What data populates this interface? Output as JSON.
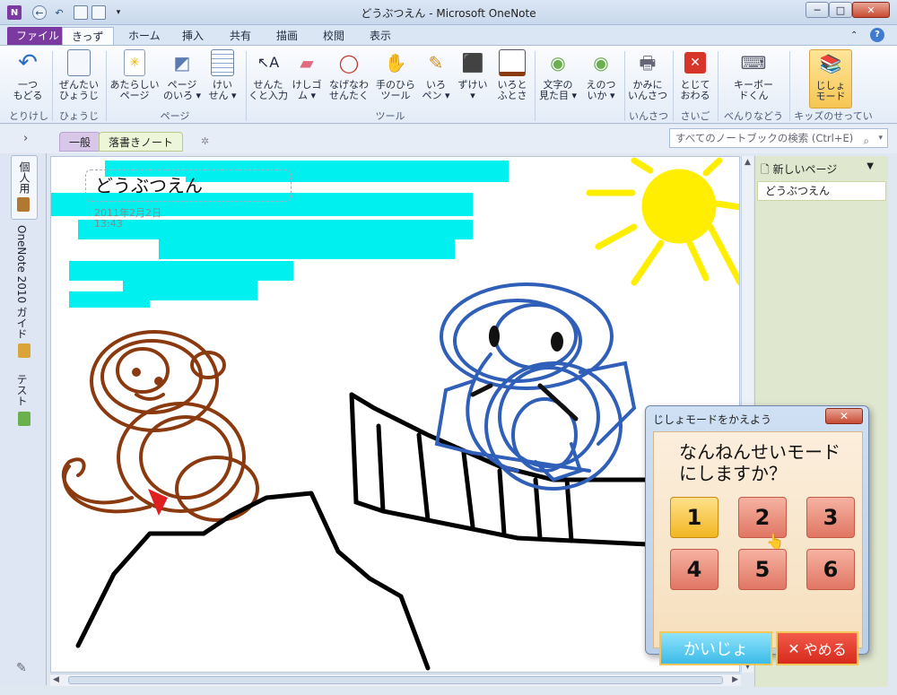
{
  "window": {
    "title": "どうぶつえん - Microsoft OneNote",
    "app_icon": "N",
    "controls": {
      "minimize": "─",
      "maximize": "□",
      "close": "✕"
    }
  },
  "tabs": [
    "ファイル",
    "きっず",
    "ホーム",
    "挿入",
    "共有",
    "描画",
    "校閲",
    "表示"
  ],
  "ribbon": {
    "buttons": [
      {
        "label": "一つ\nもどる",
        "icon": "undo-icon"
      },
      {
        "label": "ぜんたい\nひょうじ",
        "icon": "full-view-icon"
      },
      {
        "label": "あたらしい\nページ",
        "icon": "new-page-icon"
      },
      {
        "label": "ページ\nのいろ ▾",
        "icon": "page-color-icon"
      },
      {
        "label": "けい\nせん ▾",
        "icon": "rule-lines-icon"
      },
      {
        "label": "せんた\nくと入力",
        "icon": "select-text-icon"
      },
      {
        "label": "けしゴ\nム ▾",
        "icon": "eraser-icon"
      },
      {
        "label": "なげなわ\nせんたく",
        "icon": "lasso-icon"
      },
      {
        "label": "手のひら\nツール",
        "icon": "hand-tool-icon"
      },
      {
        "label": "いろ\nペン ▾",
        "icon": "color-pen-icon"
      },
      {
        "label": "ずけい\n▾",
        "icon": "shapes-icon"
      },
      {
        "label": "いろと\nふとさ",
        "icon": "color-thickness-icon"
      },
      {
        "label": "文字の\n見た目 ▾",
        "icon": "text-style-icon"
      },
      {
        "label": "えのつ\nいか ▾",
        "icon": "add-picture-icon"
      },
      {
        "label": "かみに\nいんさつ",
        "icon": "print-icon"
      },
      {
        "label": "とじて\nおわる",
        "icon": "close-app-icon"
      },
      {
        "label": "キーボー\nドくん",
        "icon": "keyboard-icon"
      },
      {
        "label": "じしょ\nモード",
        "icon": "dictionary-icon"
      }
    ],
    "groups": [
      "とりけし",
      "ひょうじ",
      "ページ",
      "ツール",
      "いんさつ",
      "さいご",
      "べんりなどうぐ",
      "キッズのせってい"
    ]
  },
  "notebook": {
    "sections": [
      "一般",
      "落書きノート"
    ],
    "new_section": "✲",
    "search_placeholder": "すべてのノートブックの検索 (Ctrl+E)"
  },
  "left_nav": [
    "個人用",
    "OneNote 2010 ガイド",
    "テスト"
  ],
  "page": {
    "title": "どうぶつえん",
    "date": "2011年2月2日",
    "time": "13:43"
  },
  "page_panel": {
    "new_page": "新しいページ",
    "pages": [
      "どうぶつえん"
    ]
  },
  "dialog": {
    "title": "じしょモードをかえよう",
    "question": "なんねんせいモード\nにしますか？",
    "grades": [
      "1",
      "2",
      "3",
      "4",
      "5",
      "6"
    ],
    "selected_grade": "1",
    "ok_label": "かいじょ",
    "cancel_label": "やめる"
  },
  "colors": {
    "kids_tab_accent": "#7a3aa0",
    "drawing_cyan": "#00f0f0",
    "drawing_yellow": "#ffee00",
    "drawing_brown": "#8b3a10",
    "drawing_blue": "#2f5fb8",
    "drawing_black": "#000000"
  }
}
